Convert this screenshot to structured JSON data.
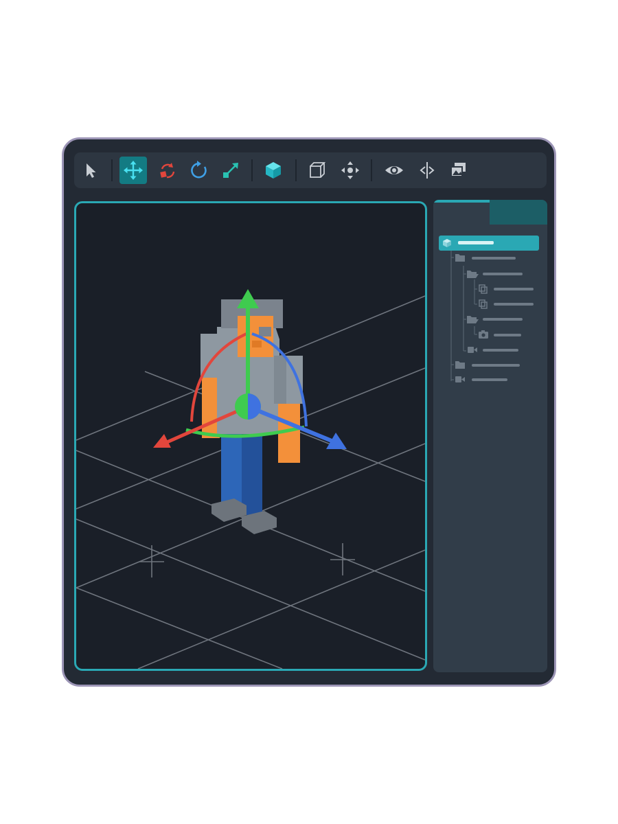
{
  "window": {
    "toolbar": {
      "tools": [
        {
          "icon": "select-cursor-icon",
          "active": false
        },
        {
          "icon": "move-arrows-icon",
          "active": true
        },
        {
          "icon": "rotate-arrows-icon",
          "active": false
        },
        {
          "icon": "refresh-rotate-icon",
          "active": false
        },
        {
          "icon": "scale-arrows-icon",
          "active": false
        },
        {
          "icon": "cube-solid-icon",
          "active": false
        },
        {
          "icon": "cube-wireframe-icon",
          "active": false
        },
        {
          "icon": "pan-dpad-icon",
          "active": false
        },
        {
          "icon": "eye-icon",
          "active": false
        },
        {
          "icon": "mirror-split-icon",
          "active": false
        },
        {
          "icon": "image-layers-icon",
          "active": false
        }
      ]
    },
    "viewport": {
      "gizmo_colors": {
        "x": "#e2463c",
        "y": "#3fcb4f",
        "z": "#3f72e0"
      },
      "character_colors": {
        "head": "#7b838d",
        "skin": "#f3903a",
        "shirt": "#8e98a1",
        "pants": "#2d66b8",
        "shoes": "#6d747c"
      }
    },
    "outliner": {
      "tabs": [
        {
          "name": "tab-1",
          "active": true
        },
        {
          "name": "tab-2",
          "active": false
        }
      ],
      "items": [
        {
          "icon": "cube-icon",
          "depth": 0,
          "selected": true
        },
        {
          "icon": "folder-icon",
          "depth": 1,
          "selected": false
        },
        {
          "icon": "folder-open-icon",
          "depth": 2,
          "selected": false
        },
        {
          "icon": "copy-icon",
          "depth": 3,
          "selected": false
        },
        {
          "icon": "copy-icon",
          "depth": 3,
          "selected": false
        },
        {
          "icon": "folder-open-icon",
          "depth": 2,
          "selected": false
        },
        {
          "icon": "camera-icon",
          "depth": 3,
          "selected": false
        },
        {
          "icon": "video-camera-icon",
          "depth": 2,
          "selected": false
        },
        {
          "icon": "folder-icon",
          "depth": 1,
          "selected": false
        },
        {
          "icon": "video-camera-icon",
          "depth": 1,
          "selected": false
        }
      ]
    },
    "accent_color": "#2aa8b4"
  }
}
